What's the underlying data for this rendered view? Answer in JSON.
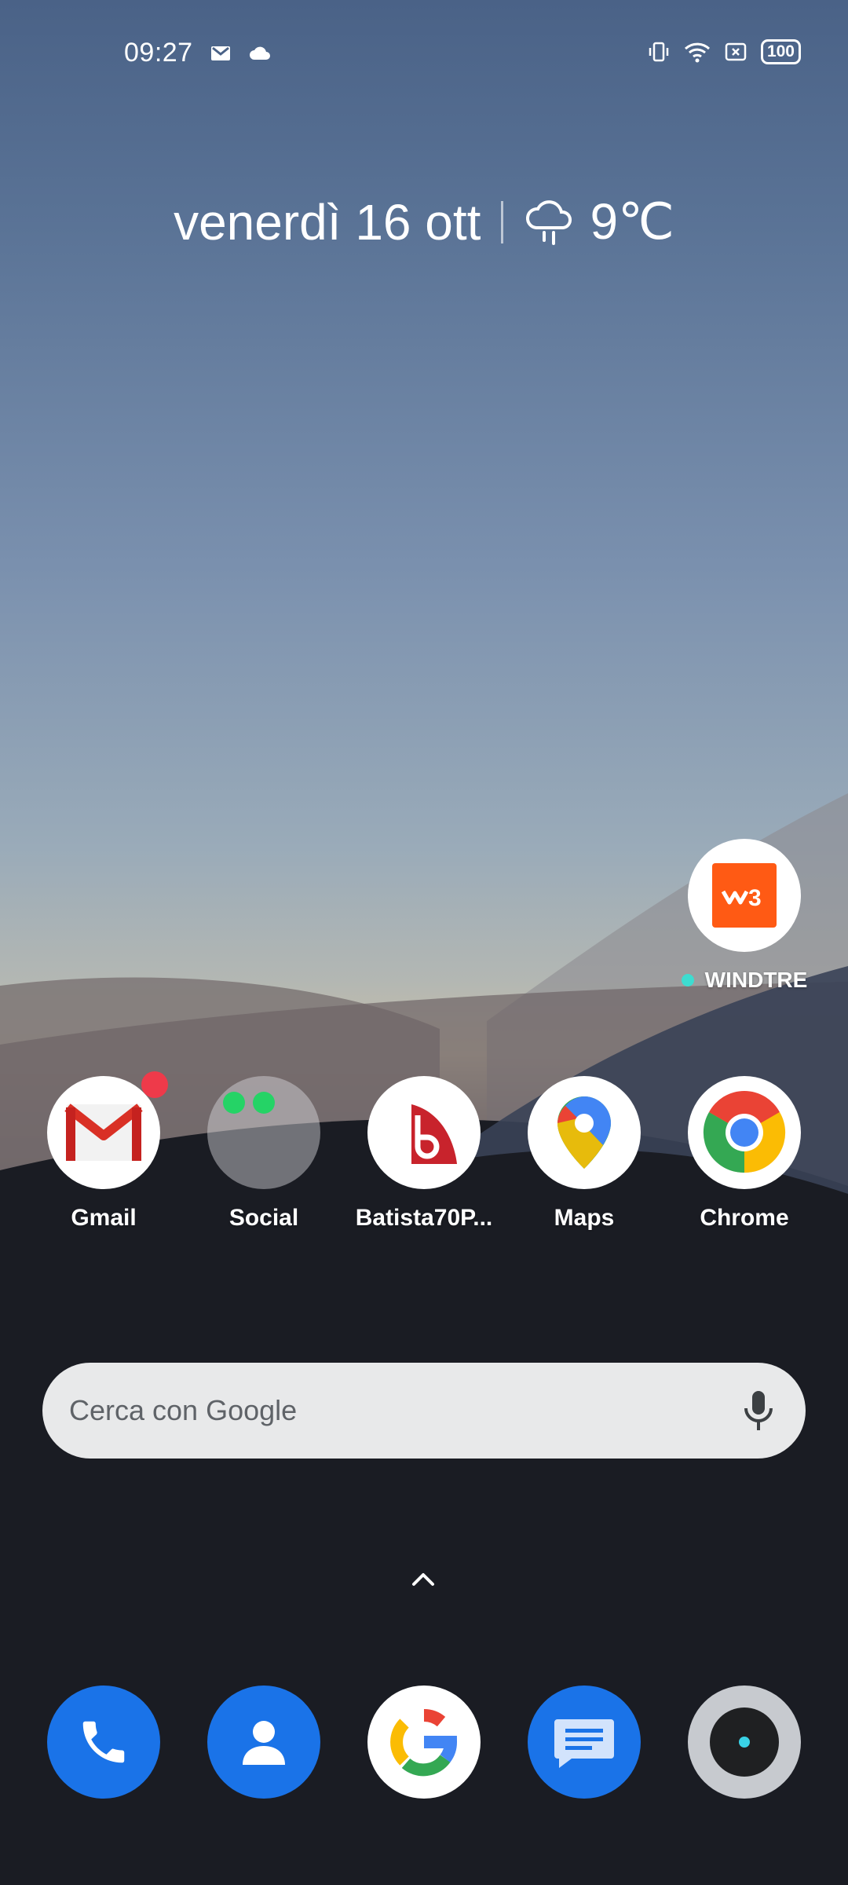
{
  "status": {
    "time": "09:27",
    "battery": "100",
    "left_icons": [
      "gmail-notification-icon",
      "cloud-icon"
    ],
    "right_icons": [
      "vibrate-icon",
      "wifi-icon",
      "nfc-icon",
      "battery-icon"
    ]
  },
  "date_widget": {
    "date": "venerdì 16 ott",
    "temperature": "9℃",
    "weather_icon": "rain-cloud-icon"
  },
  "widget_app": {
    "label": "WINDTRE",
    "dot_color": "#3ddcd0",
    "brand_color": "#ff5a14"
  },
  "apps": [
    {
      "label": "Gmail",
      "icon": "gmail-icon",
      "has_badge": true
    },
    {
      "label": "Social",
      "icon": "social-folder-icon"
    },
    {
      "label": "Batista70P...",
      "icon": "batista-app-icon"
    },
    {
      "label": "Maps",
      "icon": "maps-icon"
    },
    {
      "label": "Chrome",
      "icon": "chrome-icon"
    }
  ],
  "search": {
    "placeholder": "Cerca con Google",
    "mic_icon": "microphone-icon"
  },
  "drawer_icon": "chevron-up-icon",
  "dock": [
    {
      "icon": "phone-icon",
      "color": "#1a73e8"
    },
    {
      "icon": "contacts-icon",
      "color": "#1a73e8"
    },
    {
      "icon": "google-icon",
      "color": "#ffffff"
    },
    {
      "icon": "messages-icon",
      "color": "#1a73e8"
    },
    {
      "icon": "camera-icon",
      "color": "#c7cacf"
    }
  ]
}
